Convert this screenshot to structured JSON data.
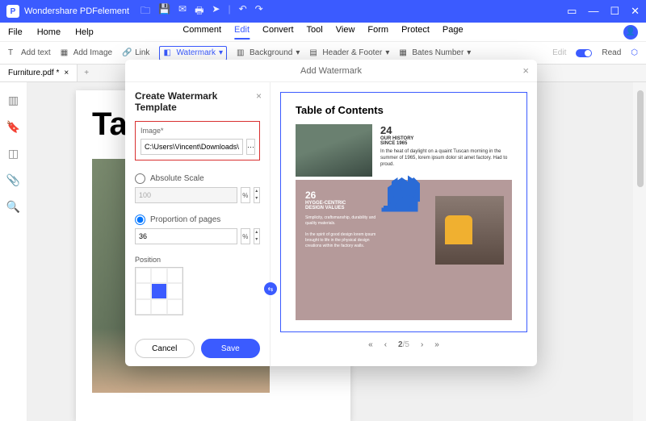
{
  "app": {
    "title": "Wondershare PDFelement"
  },
  "menu": {
    "left": [
      "File",
      "Home",
      "Help"
    ],
    "center": [
      "Comment",
      "Edit",
      "Convert",
      "Tool",
      "View",
      "Form",
      "Protect",
      "Page"
    ],
    "active": "Edit"
  },
  "toolbar": {
    "addText": "Add text",
    "addImage": "Add Image",
    "link": "Link",
    "watermark": "Watermark",
    "background": "Background",
    "headerFooter": "Header & Footer",
    "batesNumber": "Bates Number",
    "edit": "Edit",
    "read": "Read"
  },
  "tab": {
    "name": "Furniture.pdf *"
  },
  "bgPage": {
    "title": "Ta"
  },
  "modal": {
    "title": "Add Watermark",
    "panelTitle": "Create Watermark Template",
    "imageLabel": "Image*",
    "imagePath": "C:\\Users\\Vincent\\Downloads\\good.",
    "absScale": "Absolute Scale",
    "absValue": "100",
    "propPages": "Proportion of pages",
    "propValue": "36",
    "pctUnit": "%",
    "position": "Position",
    "cancel": "Cancel",
    "save": "Save"
  },
  "preview": {
    "title": "Table of Contents",
    "n1": "24",
    "h1a": "OUR HISTORY",
    "h1b": "SINCE 1965",
    "n2": "26",
    "h2a": "HYGGE-CENTRIC",
    "h2b": "DESIGN VALUES"
  },
  "pager": {
    "page": "2",
    "sep": "/5"
  }
}
